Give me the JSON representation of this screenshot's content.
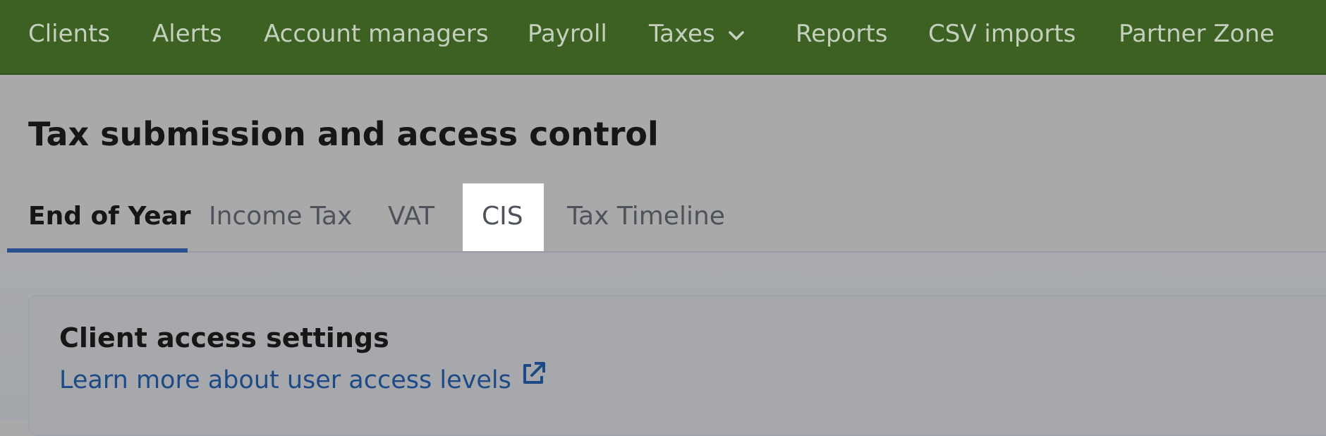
{
  "topnav": {
    "items": [
      {
        "label": "Clients"
      },
      {
        "label": "Alerts"
      },
      {
        "label": "Account managers"
      },
      {
        "label": "Payroll"
      },
      {
        "label": "Taxes",
        "icon": "chevron-down-icon"
      },
      {
        "label": "Reports"
      },
      {
        "label": "CSV imports"
      },
      {
        "label": "Partner Zone"
      }
    ]
  },
  "page": {
    "title": "Tax submission and access control"
  },
  "tabs": {
    "active": "End of Year",
    "items": [
      {
        "label": "End of Year"
      },
      {
        "label": "Income Tax"
      },
      {
        "label": "VAT"
      },
      {
        "label": "CIS"
      },
      {
        "label": "Tax Timeline"
      }
    ]
  },
  "card": {
    "title": "Client access settings",
    "link_label": "Learn more about user access levels",
    "link_icon": "external-link-icon"
  },
  "colors": {
    "nav_bg": "#3c6122",
    "accent": "#2a5090",
    "link": "#1d4a86"
  }
}
